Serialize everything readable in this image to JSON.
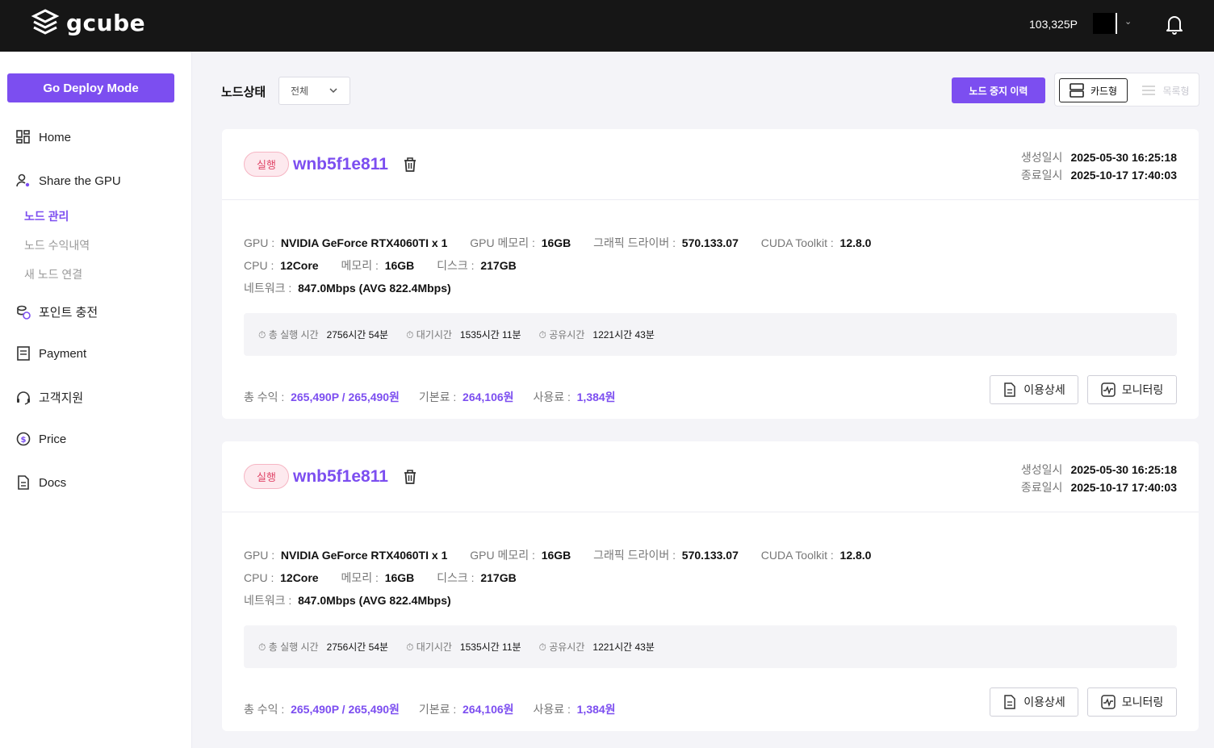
{
  "header": {
    "brand": "gcube",
    "points": "103,325P"
  },
  "sidebar": {
    "deploy_button": "Go Deploy Mode",
    "items": [
      {
        "label": "Home"
      },
      {
        "label": "Share the GPU"
      },
      {
        "label": "포인트 충전"
      },
      {
        "label": "Payment"
      },
      {
        "label": "고객지원"
      },
      {
        "label": "Price"
      },
      {
        "label": "Docs"
      }
    ],
    "sub_items": [
      {
        "label": "노드 관리"
      },
      {
        "label": "노드 수익내역"
      },
      {
        "label": "새 노드 연결"
      }
    ]
  },
  "toolbar": {
    "filter_label": "노드상태",
    "filter_value": "전체",
    "history_button": "노드 중지 이력",
    "view_card": "카드형",
    "view_list": "목록형"
  },
  "cards": [
    {
      "status": "실행",
      "name": "wnb5f1e811",
      "created_label": "생성일시",
      "created": "2025-05-30 16:25:18",
      "ended_label": "종료일시",
      "ended": "2025-10-17 17:40:03",
      "gpu_k": "GPU :",
      "gpu": "NVIDIA GeForce RTX4060TI x 1",
      "gpu_mem_k": "GPU 메모리 :",
      "gpu_mem": "16GB",
      "driver_k": "그래픽 드라이버 :",
      "driver": "570.133.07",
      "cuda_k": "CUDA Toolkit :",
      "cuda": "12.8.0",
      "cpu_k": "CPU :",
      "cpu": "12Core",
      "mem_k": "메모리 :",
      "mem": "16GB",
      "disk_k": "디스크 :",
      "disk": "217GB",
      "net_k": "네트워크 :",
      "net": "847.0Mbps (AVG 822.4Mbps)",
      "run_time_k": "⏱ 총 실행 시간",
      "run_time": "2756시간 54분",
      "wait_time_k": "⏱ 대기시간",
      "wait_time": "1535시간 11분",
      "share_time_k": "⏱ 공유시간",
      "share_time": "1221시간 43분",
      "total_k": "총 수익 :",
      "total": "265,490P / 265,490원",
      "base_k": "기본료 :",
      "base": "264,106원",
      "usage_k": "사용료 :",
      "usage": "1,384원",
      "detail_button": "이용상세",
      "monitor_button": "모니터링"
    },
    {
      "status": "실행",
      "name": "wnb5f1e811",
      "created_label": "생성일시",
      "created": "2025-05-30 16:25:18",
      "ended_label": "종료일시",
      "ended": "2025-10-17 17:40:03",
      "gpu_k": "GPU :",
      "gpu": "NVIDIA GeForce RTX4060TI x 1",
      "gpu_mem_k": "GPU 메모리 :",
      "gpu_mem": "16GB",
      "driver_k": "그래픽 드라이버 :",
      "driver": "570.133.07",
      "cuda_k": "CUDA Toolkit :",
      "cuda": "12.8.0",
      "cpu_k": "CPU :",
      "cpu": "12Core",
      "mem_k": "메모리 :",
      "mem": "16GB",
      "disk_k": "디스크 :",
      "disk": "217GB",
      "net_k": "네트워크 :",
      "net": "847.0Mbps (AVG 822.4Mbps)",
      "run_time_k": "⏱ 총 실행 시간",
      "run_time": "2756시간 54분",
      "wait_time_k": "⏱ 대기시간",
      "wait_time": "1535시간 11분",
      "share_time_k": "⏱ 공유시간",
      "share_time": "1221시간 43분",
      "total_k": "총 수익 :",
      "total": "265,490P / 265,490원",
      "base_k": "기본료 :",
      "base": "264,106원",
      "usage_k": "사용료 :",
      "usage": "1,384원",
      "detail_button": "이용상세",
      "monitor_button": "모니터링"
    }
  ],
  "colors": {
    "accent": "#7c4ef0",
    "badge_text": "#e0486a",
    "badge_bg": "#fde9ee",
    "topbar": "#161616"
  }
}
